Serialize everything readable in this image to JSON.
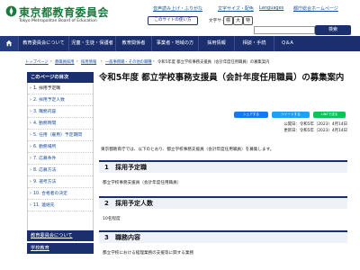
{
  "header": {
    "logo_title": "東京都教育委員会",
    "logo_sub": "Tokyo Metropolitan Board of Education",
    "util_links": [
      "音声読み上げ・ふりがな",
      "文字サイズ・配色",
      "Languages",
      "都庁総合ホームページ"
    ],
    "site_button": "このサイトの使い方",
    "font_size_label": "文字サイズ",
    "font_sizes": [
      "標",
      "大",
      "特"
    ],
    "search_placeholder": "",
    "search_button": "検索"
  },
  "gnav": {
    "items": [
      "教育委員会について",
      "児童・生徒・保護者",
      "教育関係者",
      "事業者・地域の方",
      "採用情報",
      "相談・手続",
      "Q＆A"
    ]
  },
  "breadcrumb": {
    "items": [
      "トップページ",
      "教職員採用",
      "採用情報",
      "一般事務職・その他の職種",
      "令和5年度 都立学校事務支援員（会計年度任用職員）の募集案内"
    ]
  },
  "sidebar": {
    "heading": "このページの目次",
    "items": [
      "1. 採用予定職",
      "2. 採用予定人数",
      "3. 職務内容",
      "4. 勤務時間",
      "5. 任用（雇用）予定期間",
      "6. 勤務場所",
      "7. 応募条件",
      "8. 応募方法",
      "9. 選考方法",
      "10. 合格者の決定",
      "11. 連絡先"
    ],
    "current_index": 0,
    "section_links": [
      "教育委員会について",
      "学校教育"
    ]
  },
  "main": {
    "title": "令和5年度 都立学校事務支援員（会計年度任用職員）の募集案内",
    "share_buttons": [
      "シェアする",
      "ツイートする",
      "LINEで送る"
    ],
    "published": "公開日：令和5年（2023）4月14日",
    "updated": "更新日：令和5年（2023）4月14日",
    "lead": "東京都教育庁では、以下のとおり、都立学校事務支援員（会計年度任用職員）を募集します。",
    "sections": [
      {
        "num": "1",
        "title": "採用予定職",
        "body": "都立学校事務支援員（会計年度任用職員）"
      },
      {
        "num": "2",
        "title": "採用予定人数",
        "body": "10名程度"
      },
      {
        "num": "3",
        "title": "職務内容",
        "body": "都立学校における経理業務の支援等に関する業務"
      }
    ]
  },
  "colors": {
    "brand_navy": "#1b2f6e",
    "logo_green": "#1a7a3e",
    "link_blue": "#1a4fa0",
    "share_fb": "#1877f2",
    "share_tw": "#1da1f2",
    "share_line": "#06c755"
  }
}
